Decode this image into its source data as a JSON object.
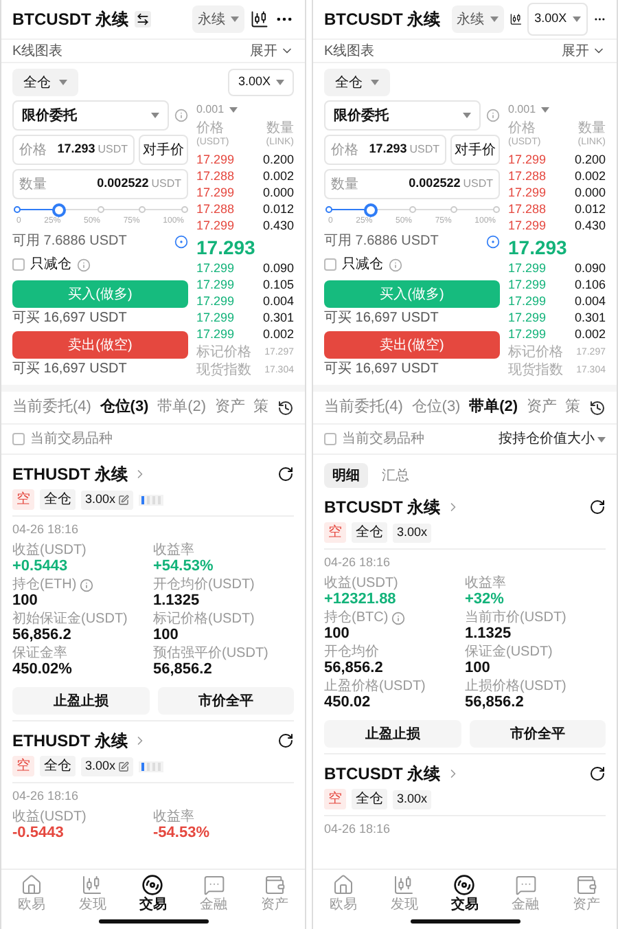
{
  "screens": [
    {
      "header": {
        "title": "BTCUSDT 永续",
        "swap_icon": true,
        "type_select": "永续"
      },
      "chart_row": {
        "label": "K线图表",
        "toggle": "展开"
      },
      "form": {
        "margin_mode": "全仓",
        "leverage": "3.00X",
        "order_type": "限价委托",
        "price_label": "价格",
        "price": "17.293",
        "price_unit": "USDT",
        "counter_price": "对手价",
        "qty_label": "数量",
        "qty": "0.002522",
        "qty_unit": "USDT",
        "slider": {
          "level": 0.25,
          "ticks": [
            "0",
            "25%",
            "50%",
            "75%",
            "100%"
          ]
        },
        "available": "可用 7.6886 USDT",
        "reduce_only": {
          "label": "只减仓",
          "checked": false
        },
        "buy": "买入(做多)",
        "buy_max": "可买 16,697 USDT",
        "sell": "卖出(做空)",
        "sell_max": "可买 16,697 USDT"
      },
      "orderbook": {
        "precision": "0.001",
        "columns": [
          {
            "label": "价格",
            "unit": "(USDT)"
          },
          {
            "label": "数量",
            "unit": "(LINK)"
          }
        ],
        "asks": [
          {
            "price": "17.299",
            "amount": "0.200"
          },
          {
            "price": "17.288",
            "amount": "0.002"
          },
          {
            "price": "17.299",
            "amount": "0.000"
          },
          {
            "price": "17.288",
            "amount": "0.012"
          },
          {
            "price": "17.299",
            "amount": "0.430"
          }
        ],
        "last": "17.293",
        "bids": [
          {
            "price": "17.299",
            "amount": "0.090"
          },
          {
            "price": "17.299",
            "amount": "0.105"
          },
          {
            "price": "17.299",
            "amount": "0.004"
          },
          {
            "price": "17.299",
            "amount": "0.301"
          },
          {
            "price": "17.299",
            "amount": "0.002"
          }
        ],
        "footer": [
          {
            "label": "标记价格",
            "value": "17.297"
          },
          {
            "label": "现货指数",
            "value": "17.304"
          }
        ]
      },
      "tabs": [
        {
          "label": "当前委托(4)",
          "selected": false
        },
        {
          "label": "仓位(3)",
          "selected": true
        },
        {
          "label": "带单(2)",
          "selected": false
        },
        {
          "label": "资产",
          "selected": false
        },
        {
          "label": "策",
          "selected": false
        }
      ],
      "filter": {
        "label": "当前交易品种",
        "checked": false
      },
      "positions": [
        {
          "symbol": "ETHUSDT 永续",
          "side": "空",
          "margin": "全仓",
          "leverage": "3.00x",
          "leverage_editable": true,
          "risk_meter": true,
          "time": "04-26 18:16",
          "fields": [
            {
              "label": "收益(USDT)",
              "value": "+0.5443",
              "kind": "gain"
            },
            {
              "label": "收益率",
              "value": "+54.53%",
              "kind": "gain"
            },
            {
              "label": "持仓(ETH)",
              "value": "100",
              "info": true
            },
            {
              "label": "开仓均价(USDT)",
              "value": "1.1325"
            },
            {
              "label": "初始保证金(USDT)",
              "value": "56,856.2"
            },
            {
              "label": "标记价格(USDT)",
              "value": "100"
            },
            {
              "label": "保证金率",
              "value": "450.02%"
            },
            {
              "label": "预估强平价(USDT)",
              "value": "56,856.2"
            }
          ],
          "actions": [
            "止盈止损",
            "市价全平"
          ]
        },
        {
          "symbol": "ETHUSDT 永续",
          "side": "空",
          "margin": "全仓",
          "leverage": "3.00x",
          "leverage_editable": true,
          "risk_meter": true,
          "time": "04-26 18:16",
          "fields": [
            {
              "label": "收益(USDT)",
              "value": "-0.5443",
              "kind": "loss"
            },
            {
              "label": "收益率",
              "value": "-54.53%",
              "kind": "loss"
            }
          ]
        }
      ],
      "nav": [
        {
          "label": "欧易",
          "kind": "home",
          "selected": false
        },
        {
          "label": "发现",
          "kind": "candles",
          "selected": false
        },
        {
          "label": "交易",
          "kind": "trade",
          "selected": true
        },
        {
          "label": "金融",
          "kind": "chat",
          "selected": false
        },
        {
          "label": "资产",
          "kind": "wallet",
          "selected": false
        }
      ]
    },
    {
      "header": {
        "title": "BTCUSDT 永续",
        "swap_icon": false,
        "type_select": "永续",
        "leverage": "3.00X"
      },
      "chart_row": {
        "label": "K线图表",
        "toggle": "展开"
      },
      "form": {
        "margin_mode": "全仓",
        "order_type": "限价委托",
        "price_label": "价格",
        "price": "17.293",
        "price_unit": "USDT",
        "counter_price": "对手价",
        "qty_label": "数量",
        "qty": "0.002522",
        "qty_unit": "USDT",
        "slider": {
          "level": 0.25,
          "ticks": [
            "0",
            "25%",
            "50%",
            "75%",
            "100%"
          ]
        },
        "available": "可用 7.6886 USDT",
        "reduce_only": {
          "label": "只减仓",
          "checked": false
        },
        "buy": "买入(做多)",
        "buy_max": "可买 16,697 USDT",
        "sell": "卖出(做空)",
        "sell_max": "可买 16,697 USDT"
      },
      "orderbook": {
        "precision": "0.001",
        "columns": [
          {
            "label": "价格",
            "unit": "(USDT)"
          },
          {
            "label": "数量",
            "unit": "(LINK)"
          }
        ],
        "asks": [
          {
            "price": "17.299",
            "amount": "0.200"
          },
          {
            "price": "17.288",
            "amount": "0.002"
          },
          {
            "price": "17.299",
            "amount": "0.000"
          },
          {
            "price": "17.288",
            "amount": "0.012"
          },
          {
            "price": "17.299",
            "amount": "0.430"
          }
        ],
        "last": "17.293",
        "bids": [
          {
            "price": "17.299",
            "amount": "0.090"
          },
          {
            "price": "17.299",
            "amount": "0.106"
          },
          {
            "price": "17.299",
            "amount": "0.004"
          },
          {
            "price": "17.299",
            "amount": "0.301"
          },
          {
            "price": "17.299",
            "amount": "0.002"
          }
        ],
        "footer": [
          {
            "label": "标记价格",
            "value": "17.297"
          },
          {
            "label": "现货指数",
            "value": "17.304"
          }
        ]
      },
      "tabs": [
        {
          "label": "当前委托(4)",
          "selected": false
        },
        {
          "label": "仓位(3)",
          "selected": false
        },
        {
          "label": "带单(2)",
          "selected": true
        },
        {
          "label": "资产",
          "selected": false
        },
        {
          "label": "策",
          "selected": false
        }
      ],
      "filter": {
        "label": "当前交易品种",
        "checked": false,
        "sort": "按持仓价值大小"
      },
      "segments": [
        {
          "label": "明细",
          "selected": true
        },
        {
          "label": "汇总",
          "selected": false
        }
      ],
      "positions": [
        {
          "symbol": "BTCUSDT 永续",
          "side": "空",
          "margin": "全仓",
          "leverage": "3.00x",
          "leverage_editable": false,
          "risk_meter": false,
          "time": "04-26 18:16",
          "fields": [
            {
              "label": "收益(USDT)",
              "value": "+12321.88",
              "kind": "gain"
            },
            {
              "label": "收益率",
              "value": "+32%",
              "kind": "gain"
            },
            {
              "label": "持仓(BTC)",
              "value": "100",
              "info": true
            },
            {
              "label": "当前市价(USDT)",
              "value": "1.1325"
            },
            {
              "label": "开仓均价",
              "value": "56,856.2"
            },
            {
              "label": "保证金(USDT)",
              "value": "100"
            },
            {
              "label": "止盈价格(USDT)",
              "value": "450.02"
            },
            {
              "label": "止损价格(USDT)",
              "value": "56,856.2"
            }
          ],
          "actions": [
            "止盈止损",
            "市价全平"
          ]
        },
        {
          "symbol": "BTCUSDT 永续",
          "side": "空",
          "margin": "全仓",
          "leverage": "3.00x",
          "leverage_editable": false,
          "risk_meter": false,
          "time": "04-26 18:16"
        }
      ],
      "nav": [
        {
          "label": "欧易",
          "kind": "home",
          "selected": false
        },
        {
          "label": "发现",
          "kind": "candles",
          "selected": false
        },
        {
          "label": "交易",
          "kind": "trade",
          "selected": true
        },
        {
          "label": "金融",
          "kind": "chat",
          "selected": false
        },
        {
          "label": "资产",
          "kind": "wallet",
          "selected": false
        }
      ]
    }
  ]
}
